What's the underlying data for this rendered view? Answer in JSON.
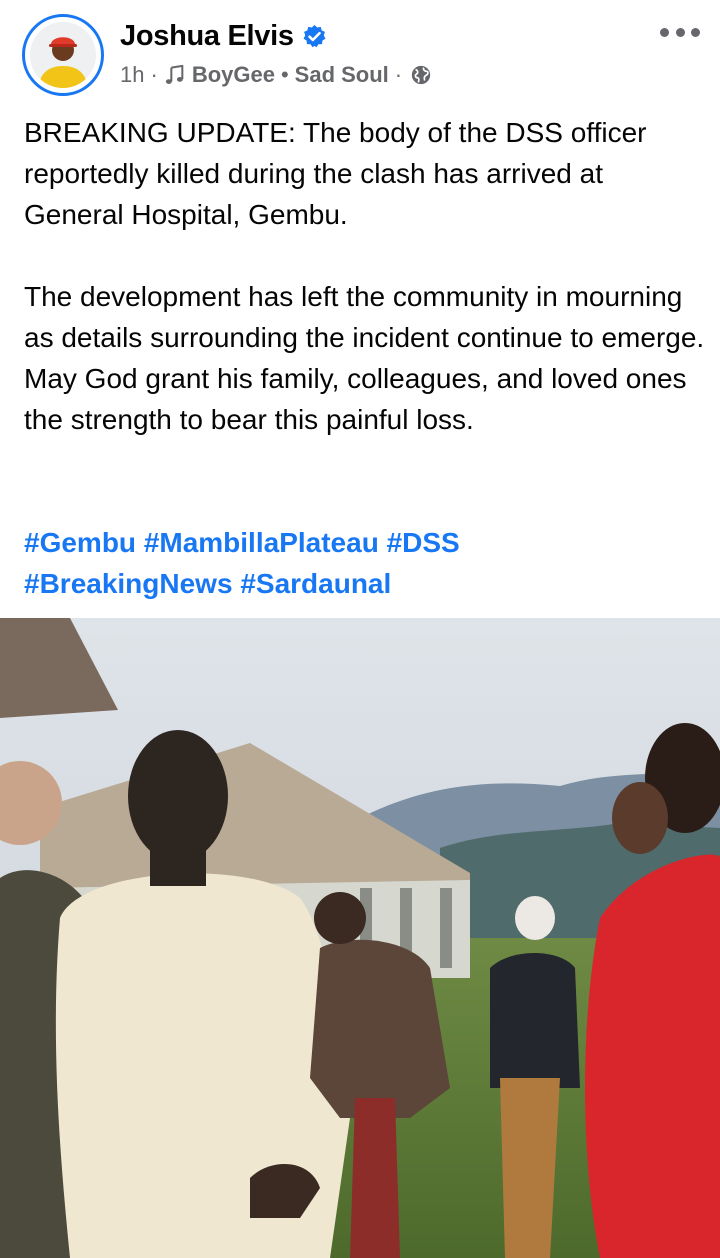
{
  "post": {
    "author": "Joshua Elvis",
    "time": "1h",
    "audio_artist": "BoyGee",
    "audio_title": "Sad Soul",
    "icons": {
      "verified": "verified-badge-icon",
      "music": "music-note-icon",
      "audience": "globe-icon",
      "more": "more-options-icon"
    },
    "colors": {
      "accent": "#1877f2",
      "meta": "#65676b",
      "text": "#050505"
    },
    "paragraphs": [
      "BREAKING UPDATE: The body of the DSS officer reportedly killed during the clash has arrived at General Hospital, Gembu.",
      "The development has left the community in mourning as details surrounding the incident continue to emerge. May God grant his family, colleagues, and loved ones the strength to bear this painful loss."
    ],
    "hashtags": [
      "#Gembu",
      "#MambillaPlateau",
      "#DSS",
      "#BreakingNews",
      "#Sardaunal"
    ]
  }
}
